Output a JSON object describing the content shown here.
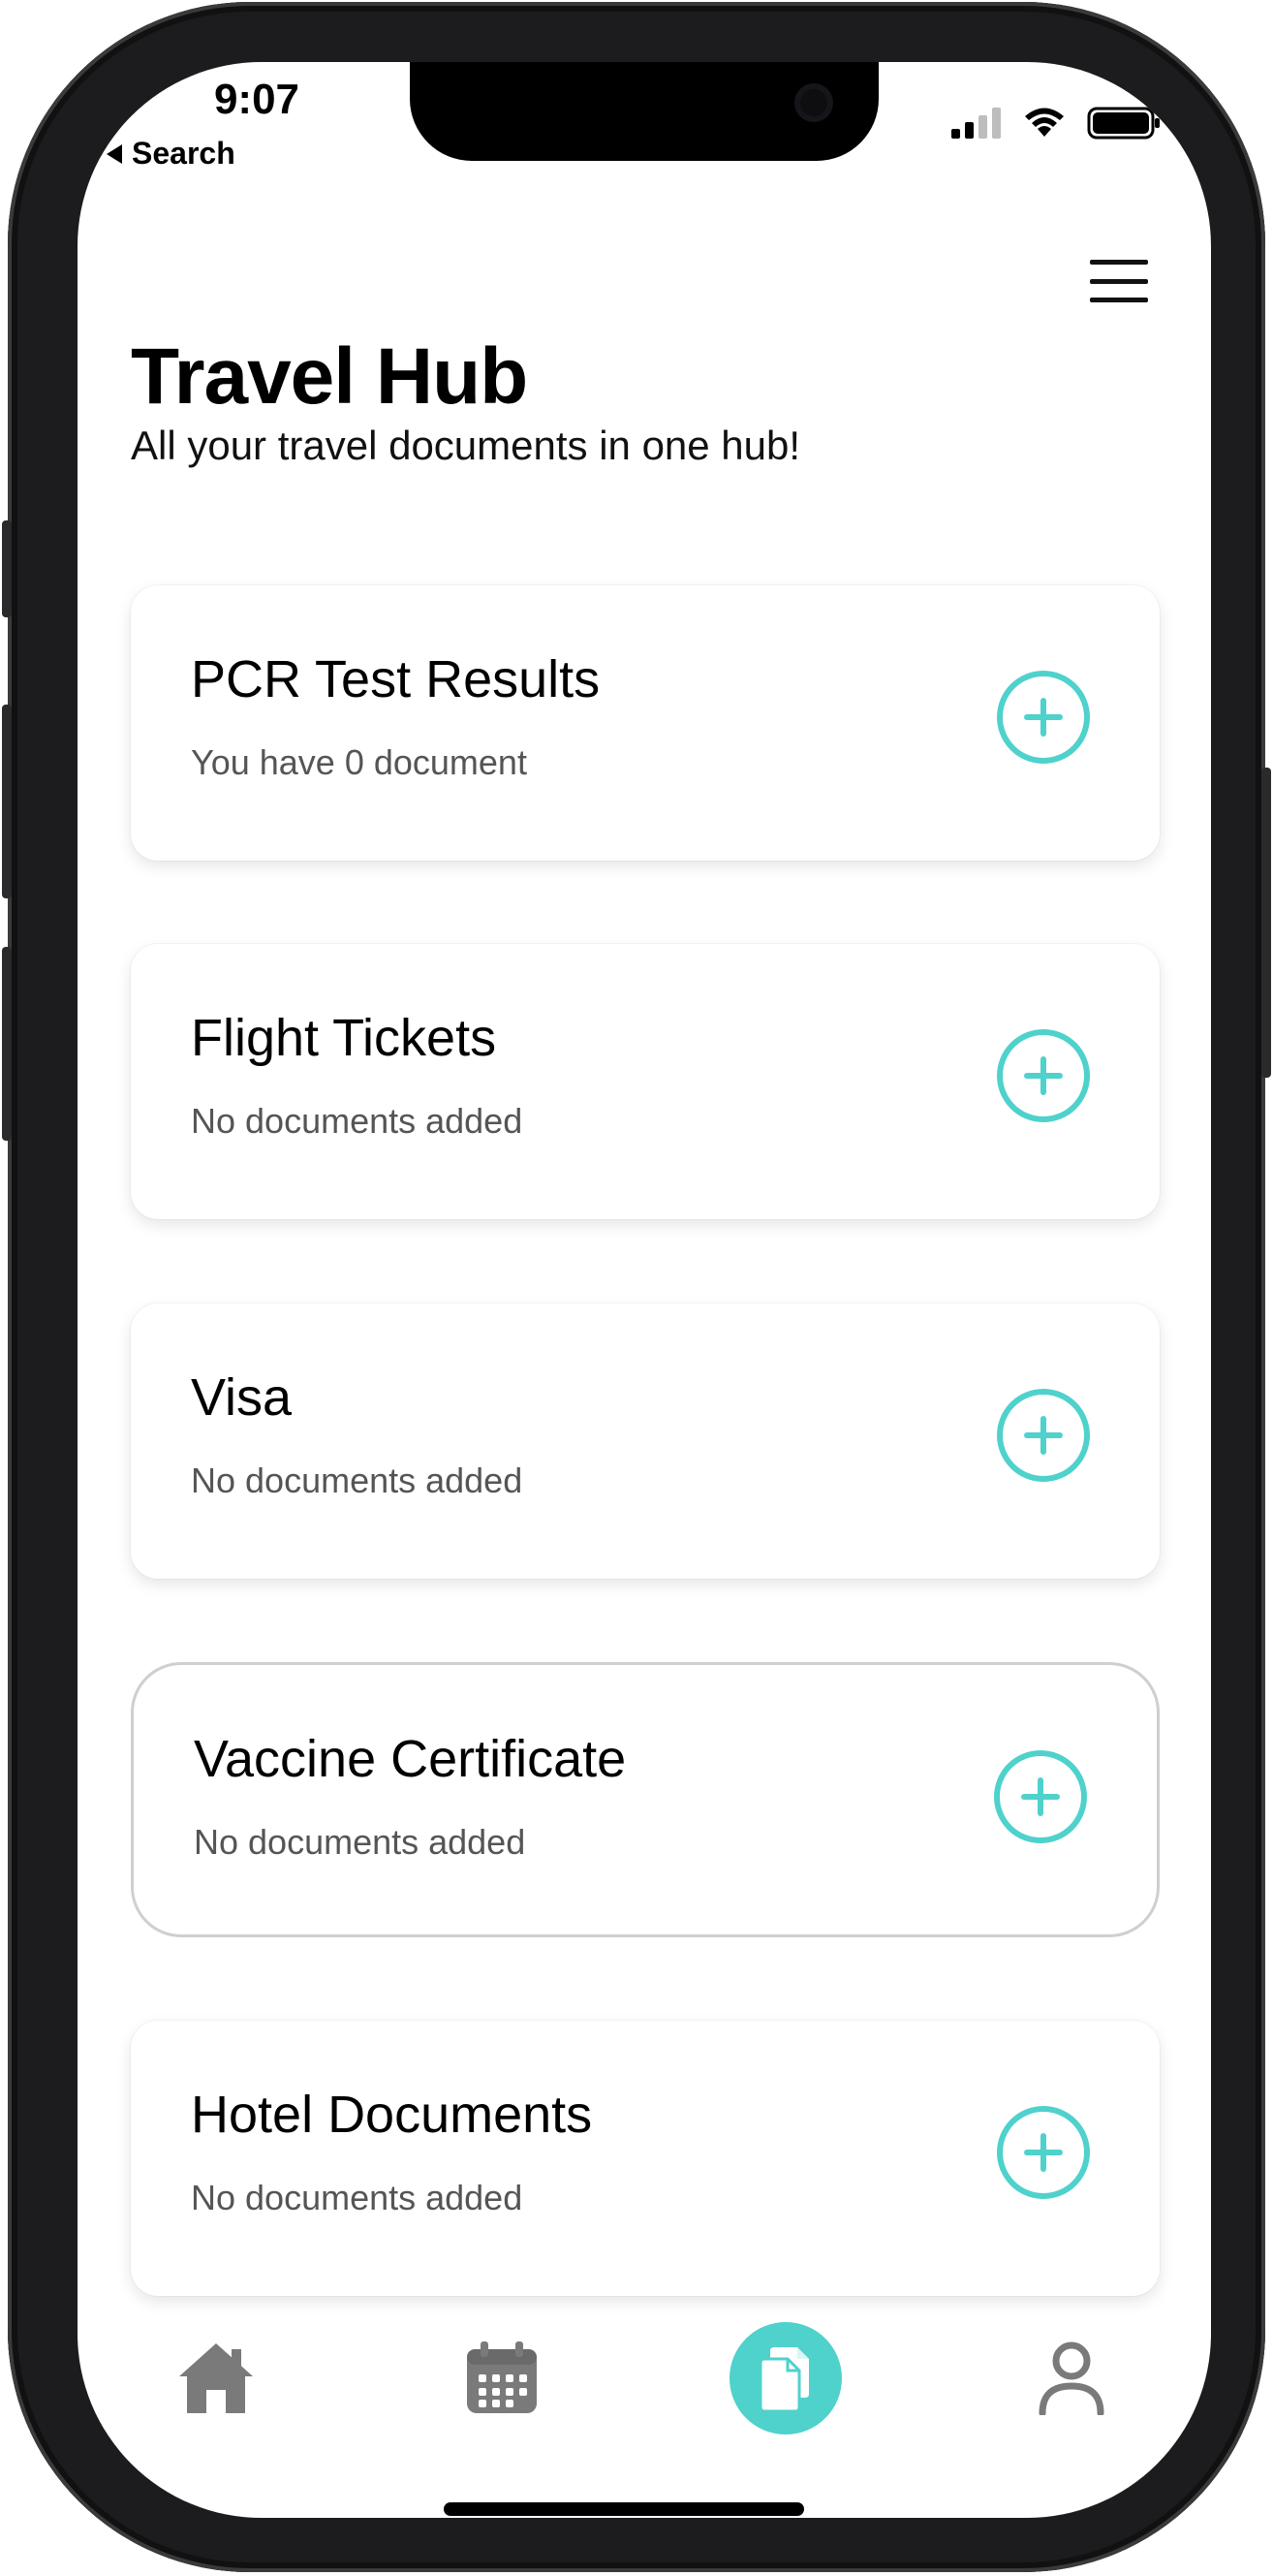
{
  "status_bar": {
    "time": "9:07",
    "back_label": "Search"
  },
  "header": {
    "title": "Travel Hub",
    "subtitle": "All your travel documents in one hub!"
  },
  "documents": [
    {
      "title": "PCR Test Results",
      "status": "You have 0 document"
    },
    {
      "title": "Flight Tickets",
      "status": "No documents added"
    },
    {
      "title": "Visa",
      "status": "No documents added"
    },
    {
      "title": "Vaccine Certificate",
      "status": "No documents added"
    },
    {
      "title": "Hotel Documents",
      "status": "No documents added"
    }
  ],
  "tab_bar": {
    "items": [
      "home-icon",
      "calendar-icon",
      "documents-icon",
      "profile-icon"
    ],
    "active": "documents-icon"
  },
  "colors": {
    "accent": "#4fd1cc",
    "tab_inactive": "#7a7a7a"
  }
}
